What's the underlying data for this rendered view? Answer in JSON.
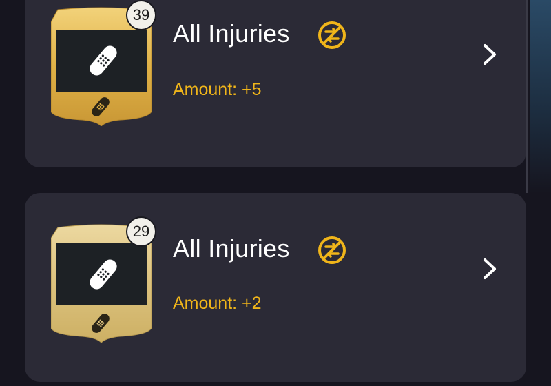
{
  "items": [
    {
      "count": "39",
      "title": "All Injuries",
      "amount": "Amount: +5",
      "card_color": "#e3b64c",
      "untradeable_icon": "untradeable-icon",
      "arrow_icon": "chevron-right-icon"
    },
    {
      "count": "29",
      "title": "All Injuries",
      "amount": "Amount: +2",
      "card_color": "#dcc27e",
      "untradeable_icon": "untradeable-icon",
      "arrow_icon": "chevron-right-icon"
    }
  ],
  "colors": {
    "background": "#16151f",
    "card_bg": "#2b2a36",
    "accent": "#f0b51a",
    "text": "#ffffff"
  }
}
